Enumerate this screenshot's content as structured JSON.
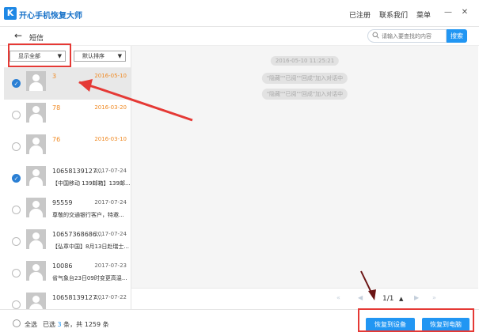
{
  "app": {
    "logo_letter": "K",
    "title": "开心手机恢复大师"
  },
  "topmenu": {
    "registered": "已注册",
    "contact": "联系我们",
    "menu": "菜单"
  },
  "window": {
    "minimize": "—",
    "close": "✕"
  },
  "subheader": {
    "back": "←",
    "title": "短信"
  },
  "search": {
    "placeholder": "请输入要查找的内容",
    "button": "搜索"
  },
  "filters": {
    "show": "显示全部",
    "sort": "默认排序"
  },
  "messages": [
    {
      "name": "3",
      "date": "2016-05-10",
      "preview": "",
      "checked": true,
      "orange": true,
      "selected": true
    },
    {
      "name": "78",
      "date": "2016-03-20",
      "preview": "",
      "checked": false,
      "orange": true,
      "selected": false
    },
    {
      "name": "76",
      "date": "2016-03-10",
      "preview": "",
      "checked": false,
      "orange": true,
      "selected": false
    },
    {
      "name": "10658139127...",
      "date": "2017-07-24",
      "preview": "【中国移动 139邮箱】139邮...",
      "checked": true,
      "orange": false,
      "selected": false
    },
    {
      "name": "95559",
      "date": "2017-07-24",
      "preview": "尊敬的交通银行客户，特邀...",
      "checked": false,
      "orange": false,
      "selected": false
    },
    {
      "name": "10657368686...",
      "date": "2017-07-24",
      "preview": "【弘章中国】8月13日赴瑞士...",
      "checked": false,
      "orange": false,
      "selected": false
    },
    {
      "name": "10086",
      "date": "2017-07-23",
      "preview": "省气象台23日09时变更高温...",
      "checked": false,
      "orange": false,
      "selected": false
    },
    {
      "name": "10658139127...",
      "date": "2017-07-22",
      "preview": "",
      "checked": false,
      "orange": false,
      "selected": false
    }
  ],
  "chat": {
    "timestamp": "2016-05-10 11:25:21",
    "system_lines": [
      "\"隐藏\"\"已阅\"\"回成\"加入对话中",
      "\"隐藏\"\"已阅\"\"回成\"加入对话中"
    ]
  },
  "pager": {
    "first": "«",
    "prev": "◀",
    "page": "1/1",
    "up": "▲",
    "next": "▶",
    "last": "»"
  },
  "footer": {
    "select_all": "全选",
    "selected_prefix": "已选 ",
    "selected_count": "3",
    "selected_suffix": " 条，共 1259 条",
    "restore_device": "恢复到设备",
    "restore_pc": "恢复到电脑"
  },
  "colors": {
    "accent": "#2196f3",
    "highlight": "#e53935",
    "orange": "#f08a24",
    "dark_arrow": "#6b1414"
  }
}
